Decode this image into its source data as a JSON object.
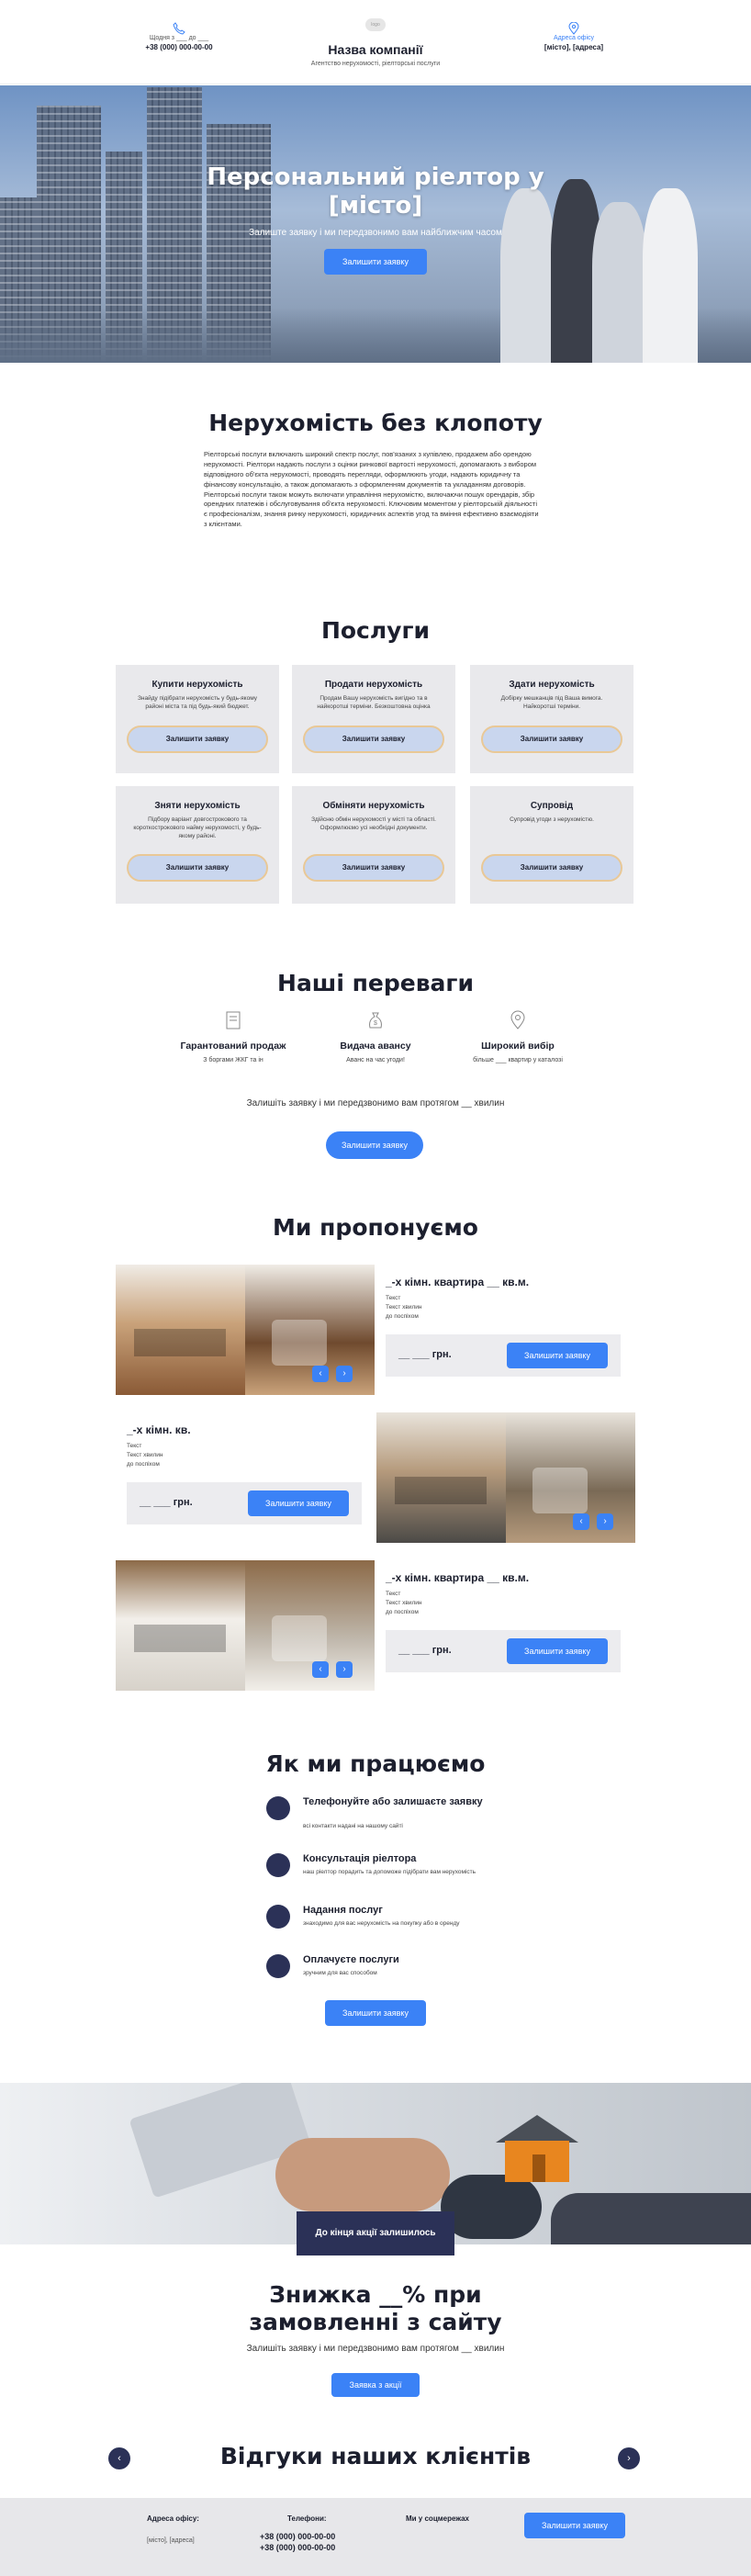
{
  "header": {
    "hours": "Щодня з ___ до ___",
    "phone": "+38 (000) 000-00-00",
    "logo": "logo",
    "company_name": "Назва компанії",
    "tagline": "Агентство нерухомості, ріелторські послуги",
    "office_label": "Адреса офісу",
    "address": "[місто], [адреса]"
  },
  "hero": {
    "title_line1": "Персональний ріелтор у",
    "title_line2": "[місто]",
    "subtitle": "Залиште заявку і ми передзвонимо вам найближчим часом",
    "cta": "Залишити заявку"
  },
  "about": {
    "title": "Нерухомість без клопоту",
    "text": "Ріелторські послуги включають широкий спектр послуг, пов'язаних з купівлею, продажем або орендою нерухомості. Ріелтори надають послуги з оцінки ринкової вартості нерухомості, допомагають з вибором відповідного об'єкта нерухомості, проводять перегляди, оформлюють угоди, надають юридичну та фінансову консультацію, а також допомагають з оформленням документів та укладанням договорів. Ріелторські послуги також можуть включати управління нерухомістю, включаючи пошук орендарів, збір орендних платежів і обслуговування об'єкта нерухомості. Ключовим моментом у ріелторській діяльності є професіоналізм, знання ринку нерухомості, юридичних аспектів угод та вміння ефективно взаємодіяти з клієнтами."
  },
  "services": {
    "title": "Послуги",
    "items": [
      {
        "title": "Купити нерухомість",
        "desc": "Знайду підібрати нерухомість у будь-якому районі міста та під будь-який бюджет.",
        "button": "Залишити заявку"
      },
      {
        "title": "Продати нерухомість",
        "desc": "Продам Вашу нерухомість вигідно та в найкоротші терміни. Безкоштовна оцінка",
        "button": "Залишити заявку"
      },
      {
        "title": "Здати нерухомість",
        "desc": "Добірку мешканців під Ваша вимога. Найкоротші терміни.",
        "button": "Залишити заявку"
      },
      {
        "title": "Зняти нерухомість",
        "desc": "Підбору варіант довгострокового та короткострокового найму нерухомості, у будь-якому районі.",
        "button": "Залишити заявку"
      },
      {
        "title": "Обміняти нерухомість",
        "desc": "Здійсню обмін нерухомості у місті та області. Оформлюємо усі необхідні документи.",
        "button": "Залишити заявку"
      },
      {
        "title": "Супровід",
        "desc": "Супровід угоди з нерухомістю.",
        "button": "Залишити заявку"
      }
    ]
  },
  "advantages": {
    "title": "Наші переваги",
    "items": [
      {
        "icon": "document-icon",
        "title": "Гарантований продаж",
        "desc": "З боргами ЖКГ та ін"
      },
      {
        "icon": "money-bag-icon",
        "title": "Видача авансу",
        "desc": "Аванс на час угоди!"
      },
      {
        "icon": "location-pin-icon",
        "title": "Широкий вибір",
        "desc": "більше ___ квартир у каталозі"
      }
    ],
    "note": "Залишіть заявку і ми передзвонимо вам протягом __ хвилин",
    "cta": "Залишити заявку"
  },
  "offers": {
    "title": "Ми пропонуємо",
    "items": [
      {
        "title": "_-х кімн. квартира __ кв.м.",
        "text": [
          "Текст",
          "Текст хвилин",
          "до поспіхом"
        ],
        "price": "__ ___ грн.",
        "button": "Залишити заявку"
      },
      {
        "title": "_-х кімн. кв.",
        "text": [
          "Текст",
          "Текст хвилин",
          "до поспіхом"
        ],
        "price": "__ ___ грн.",
        "button": "Залишити заявку"
      },
      {
        "title": "_-х кімн. квартира __ кв.м.",
        "text": [
          "Текст",
          "Текст хвилин",
          "до поспіхом"
        ],
        "price": "__ ___ грн.",
        "button": "Залишити заявку"
      }
    ]
  },
  "process": {
    "title": "Як ми працюємо",
    "steps": [
      {
        "title": "Телефонуйте або залишаєте заявку",
        "desc": "всі контакти надані на нашому сайті"
      },
      {
        "title": "Консультація ріелтора",
        "desc": "наш ріелтор порадить та допоможе підібрати вам нерухомість"
      },
      {
        "title": "Надання послуг",
        "desc": "знаходимо для вас нерухомість на покупку або в оренду"
      },
      {
        "title": "Оплачуєте послуги",
        "desc": "зручним для вас способом"
      }
    ],
    "cta": "Залишити заявку"
  },
  "promo": {
    "badge": "До кінця акції залишилось",
    "title_line1": "Знижка __% при",
    "title_line2": "замовленні з сайту",
    "note": "Залишіть заявку і ми передзвонимо вам протягом __ хвилин",
    "cta": "Заявка з акції"
  },
  "reviews": {
    "title": "Відгуки наших клієнтів"
  },
  "footer": {
    "office_label": "Адреса офісу:",
    "address": "[місто], [адреса]",
    "phones_label": "Телефони:",
    "phone1": "+38 (000) 000-00-00",
    "phone2": "+38 (000) 000-00-00",
    "social_label": "Ми у соцмережах",
    "cta": "Залишити заявку"
  },
  "colors": {
    "accent": "#3b82f6",
    "dark": "#2b3157",
    "card": "#e9e9ec"
  }
}
